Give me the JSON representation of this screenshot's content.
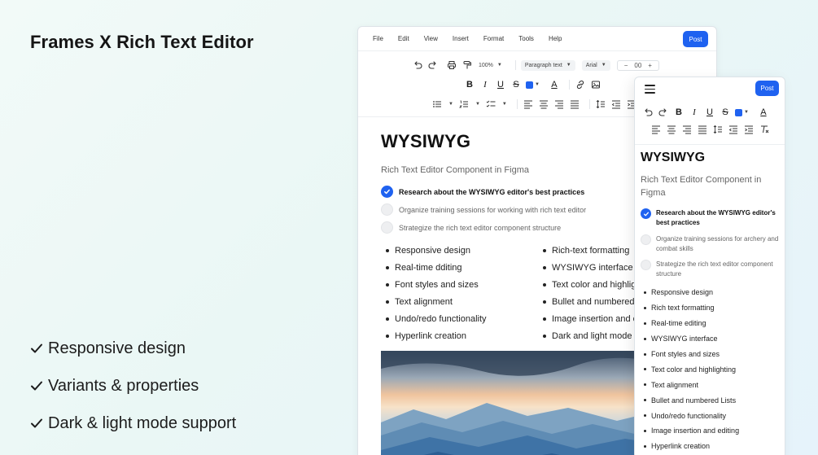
{
  "hero": {
    "title": "Frames X Rich Text Editor",
    "features": [
      "Responsive design",
      "Variants & properties",
      "Dark & light mode support"
    ]
  },
  "editor": {
    "menu": [
      "File",
      "Edit",
      "View",
      "Insert",
      "Format",
      "Tools",
      "Help"
    ],
    "post_label": "Post",
    "zoom": "100%",
    "paragraph_style": "Paragraph text",
    "font": "Arial",
    "font_size": "00",
    "title": "WYSIWYG",
    "subtitle": "Rich Text Editor Component in Figma",
    "tasks": [
      {
        "label": "Research about the WYSIWYG editor's best practices",
        "done": true
      },
      {
        "label": "Organize training sessions for working with rich text editor",
        "done": false
      },
      {
        "label": "Strategize the rich text editor component structure",
        "done": false
      }
    ],
    "bullets_left": [
      "Responsive design",
      "Real-time dditing",
      "Font styles and sizes",
      "Text alignment",
      "Undo/redo functionality",
      "Hyperlink creation"
    ],
    "bullets_right": [
      "Rich-text formatting",
      "WYSIWYG interface",
      "Text color and highlighting",
      "Bullet and numbered lists",
      "Image insertion and editing",
      "Dark and light mode"
    ]
  },
  "mobile": {
    "post_label": "Post",
    "title": "WYSIWYG",
    "subtitle": "Rich Text Editor Component in Figma",
    "tasks": [
      {
        "label": "Research about the WYSIWYG editor's best practices",
        "done": true
      },
      {
        "label": "Organize training sessions for archery and combat skills",
        "done": false
      },
      {
        "label": "Strategize the rich text editor component structure",
        "done": false
      }
    ],
    "bullets": [
      "Responsive design",
      "Rich text formatting",
      "Real-time editing",
      "WYSIWYG interface",
      "Font styles and sizes",
      "Text color and highlighting",
      "Text alignment",
      "Bullet and numbered Lists",
      "Undo/redo functionality",
      "Image insertion and editing",
      "Hyperlink creation"
    ]
  },
  "colors": {
    "accent": "#1f62f0",
    "text": "#1a1a1a",
    "muted": "#666666"
  }
}
